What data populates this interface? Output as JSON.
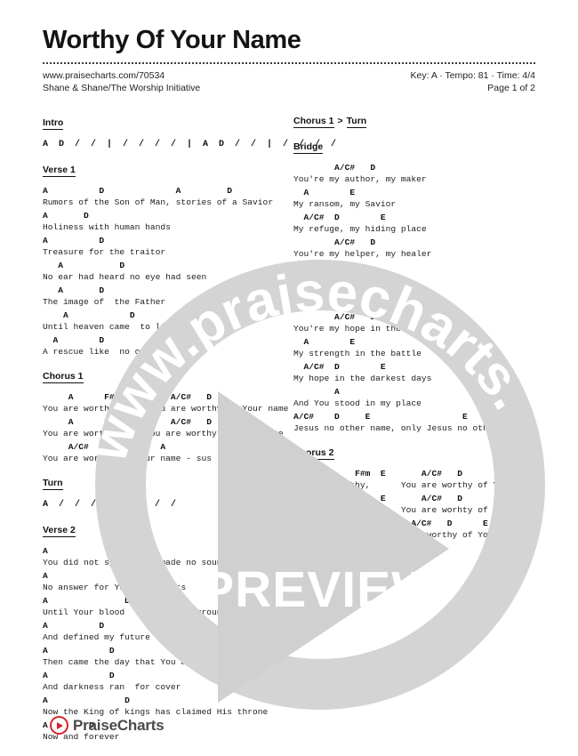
{
  "header": {
    "title": "Worthy Of Your Name",
    "url": "www.praisecharts.com/70534",
    "artist": "Shane & Shane/The Worship Initiative",
    "key_tempo_time": "Key: A · Tempo: 81 · Time: 4/4",
    "page": "Page 1 of 2"
  },
  "watermark": {
    "arc_text": "www.praisecharts.com",
    "preview_label": "PREVIEW",
    "circle_color": "#d4d4d4"
  },
  "logo": {
    "text": "PraiseCharts",
    "accent_color": "#d8232a",
    "play_icon": "play-triangle-icon"
  },
  "left_column": [
    {
      "label": "Intro",
      "type": "measures",
      "lines": [
        "A  D  /  /  |  /  /  /  /  |  A  D  /  /  |  /  /  /  /"
      ]
    },
    {
      "label": "Verse 1",
      "type": "lyrics",
      "pairs": [
        {
          "chords": "A          D              A         D",
          "lyric": "Rumors of the Son of Man, stories of a Savior"
        },
        {
          "chords": "A       D",
          "lyric": "Holiness with human hands"
        },
        {
          "chords": "A          D",
          "lyric": "Treasure for the traitor"
        },
        {
          "chords": "   A           D",
          "lyric": "No ear had heard no eye had seen"
        },
        {
          "chords": "   A       D",
          "lyric": "The image of  the Father"
        },
        {
          "chords": "    A            D",
          "lyric": "Until heaven came  to live with me"
        },
        {
          "chords": "  A        D",
          "lyric": "A rescue like  no other"
        }
      ]
    },
    {
      "label": "Chorus 1",
      "type": "lyrics",
      "pairs": [
        {
          "chords": "     A      F#m  E       A/C#   D",
          "lyric": "You are worthy,      You are worthy of Your name"
        },
        {
          "chords": "     A      F#m  E       A/C#   D",
          "lyric": "You are worthy, yes You are worthy of Your name"
        },
        {
          "chords": "     A/C#   D          A",
          "lyric": "You are worthy of Your name - sus"
        }
      ]
    },
    {
      "label": "Turn",
      "type": "measures",
      "lines": [
        "A  /  /  /  |  /  /  /  /"
      ]
    },
    {
      "label": "Verse 2",
      "type": "lyrics",
      "pairs": [
        {
          "chords": "A               D",
          "lyric": "You did not speak, You made no sound"
        },
        {
          "chords": "A               D",
          "lyric": "No answer for Your  accusers"
        },
        {
          "chords": "A               D",
          "lyric": "Until Your blood  fell to the ground"
        },
        {
          "chords": "A          D",
          "lyric": "And defined my future"
        },
        {
          "chords": "A            D",
          "lyric": "Then came the day that You arose"
        },
        {
          "chords": "A            D",
          "lyric": "And darkness ran  for cover"
        },
        {
          "chords": "A               D",
          "lyric": "Now the King of kings has claimed His throne"
        },
        {
          "chords": "A        D",
          "lyric": "Now and forever"
        }
      ]
    }
  ],
  "right_column": [
    {
      "label": "Chorus 1",
      "label2": "Turn",
      "separator": ">",
      "type": "reference"
    },
    {
      "label": "Bridge",
      "type": "lyrics",
      "pairs": [
        {
          "chords": "        A/C#   D",
          "lyric": "You're my author, my maker"
        },
        {
          "chords": "  A        E",
          "lyric": "My ransom, my Savior"
        },
        {
          "chords": "  A/C#  D        E",
          "lyric": "My refuge, my hiding place"
        },
        {
          "chords": "        A/C#   D",
          "lyric": "You're my helper, my healer"
        },
        {
          "chords": "  A        E",
          "lyric": "My blessed Redeemer"
        },
        {
          "chords": "  A/C#  D        E",
          "lyric": "My answer, my saving grace"
        },
        {
          "chords": "        A/C#   D",
          "lyric": "You're my hope in the shadows"
        },
        {
          "chords": "  A        E",
          "lyric": "My strength in the battle"
        },
        {
          "chords": "  A/C#  D        E",
          "lyric": "My hope in the darkest days"
        },
        {
          "chords": "        A",
          "lyric": "And You stood in my place"
        },
        {
          "chords": "A/C#    D     E                  E",
          "lyric": "Jesus no other name, only Jesus no other name"
        }
      ]
    },
    {
      "label": "Chorus 2",
      "type": "lyrics",
      "pairs": [
        {
          "chords": "     A      F#m  E       A/C#   D",
          "lyric": "You are worthy,      You are worthy of Your name"
        },
        {
          "chords": "     A      F#m  E       A/C#   D",
          "lyric": "You are worthy,      You are worhty of Your name"
        },
        {
          "chords": "     A      Bm         A/C#   D      E",
          "lyric": "You are worthy,   You are worthy of Your name"
        },
        {
          "chords": "                    F#m  E",
          "lyric": "            You are"
        },
        {
          "chords": "",
          "lyric": "        worthy Jesus"
        }
      ]
    }
  ]
}
